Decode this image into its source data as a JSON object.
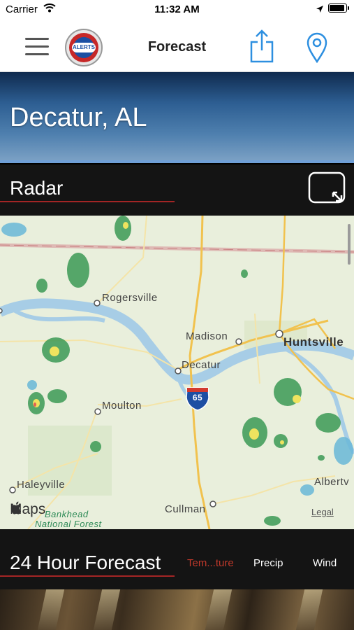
{
  "status_bar": {
    "carrier": "Carrier",
    "time": "11:32 AM"
  },
  "nav_bar": {
    "title": "Forecast",
    "logo_text": "ALERTS",
    "accent_color": "#2d8fe0"
  },
  "location": {
    "title": "Decatur, AL"
  },
  "radar": {
    "title": "Radar",
    "map": {
      "places": [
        "Rogersville",
        "Madison",
        "Huntsville",
        "Decatur",
        "Moulton",
        "Haleyville",
        "Cullman",
        "Albertv"
      ],
      "forest_label": [
        "Bankhead",
        "National Forest"
      ],
      "highway_shield": "65",
      "brand": "Maps",
      "legal": "Legal"
    }
  },
  "forecast": {
    "title": "24 Hour Forecast",
    "tabs": [
      "Tem...ture",
      "Precip",
      "Wind"
    ],
    "active_tab_color": "#c0392b"
  }
}
